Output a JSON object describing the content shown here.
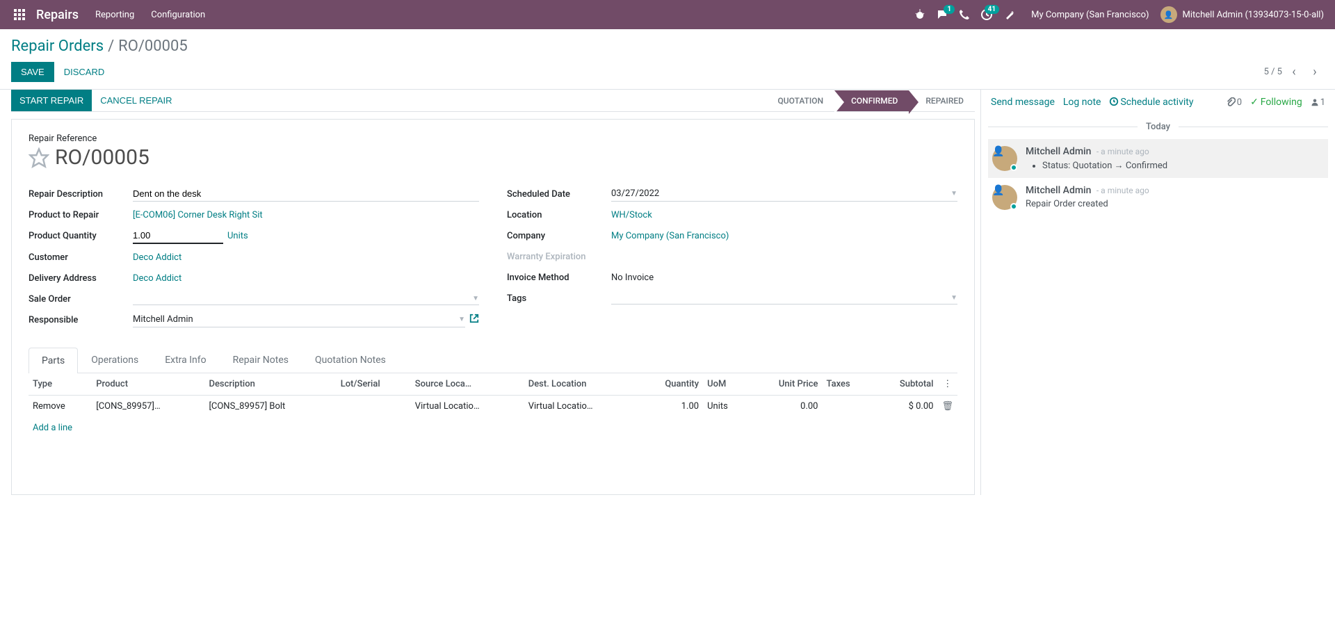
{
  "nav": {
    "brand": "Repairs",
    "menu": [
      "Reporting",
      "Configuration"
    ],
    "chat_badge": "1",
    "activity_badge": "41",
    "company": "My Company (San Francisco)",
    "user": "Mitchell Admin (13934073-15-0-all)"
  },
  "breadcrumb": {
    "parent": "Repair Orders",
    "current": "RO/00005"
  },
  "actions": {
    "save": "SAVE",
    "discard": "DISCARD"
  },
  "pager": {
    "text": "5 / 5"
  },
  "status_actions": {
    "start": "START REPAIR",
    "cancel": "CANCEL REPAIR"
  },
  "stages": {
    "quotation": "QUOTATION",
    "confirmed": "CONFIRMED",
    "repaired": "REPAIRED"
  },
  "form": {
    "ref_label": "Repair Reference",
    "ref_value": "RO/00005",
    "left": {
      "desc_label": "Repair Description",
      "desc_value": "Dent on the desk",
      "product_label": "Product to Repair",
      "product_value": "[E-COM06] Corner Desk Right Sit",
      "qty_label": "Product Quantity",
      "qty_value": "1.00",
      "qty_unit": "Units",
      "customer_label": "Customer",
      "customer_value": "Deco Addict",
      "delivery_label": "Delivery Address",
      "delivery_value": "Deco Addict",
      "sale_label": "Sale Order",
      "sale_value": "",
      "resp_label": "Responsible",
      "resp_value": "Mitchell Admin"
    },
    "right": {
      "sched_label": "Scheduled Date",
      "sched_value": "03/27/2022",
      "loc_label": "Location",
      "loc_value": "WH/Stock",
      "company_label": "Company",
      "company_value": "My Company (San Francisco)",
      "warranty_label": "Warranty Expiration",
      "warranty_value": "",
      "invoice_label": "Invoice Method",
      "invoice_value": "No Invoice",
      "tags_label": "Tags",
      "tags_value": ""
    }
  },
  "tabs": [
    "Parts",
    "Operations",
    "Extra Info",
    "Repair Notes",
    "Quotation Notes"
  ],
  "parts": {
    "headers": {
      "type": "Type",
      "product": "Product",
      "description": "Description",
      "lot": "Lot/Serial",
      "src": "Source Loca…",
      "dest": "Dest. Location",
      "qty": "Quantity",
      "uom": "UoM",
      "unit_price": "Unit Price",
      "taxes": "Taxes",
      "subtotal": "Subtotal"
    },
    "rows": [
      {
        "type": "Remove",
        "product": "[CONS_89957]…",
        "description": "[CONS_89957] Bolt",
        "lot": "",
        "src": "Virtual Locatio…",
        "dest": "Virtual Locatio…",
        "qty": "1.00",
        "uom": "Units",
        "unit_price": "0.00",
        "taxes": "",
        "subtotal": "$ 0.00"
      }
    ],
    "add_line": "Add a line"
  },
  "chatter": {
    "send": "Send message",
    "log": "Log note",
    "schedule": "Schedule activity",
    "attach_count": "0",
    "following": "Following",
    "followers": "1",
    "today": "Today",
    "messages": [
      {
        "author": "Mitchell Admin",
        "time": "- a minute ago",
        "bullets": [
          "Status: Quotation → Confirmed"
        ],
        "highlight": true
      },
      {
        "author": "Mitchell Admin",
        "time": "- a minute ago",
        "body": "Repair Order created",
        "highlight": false
      }
    ]
  }
}
